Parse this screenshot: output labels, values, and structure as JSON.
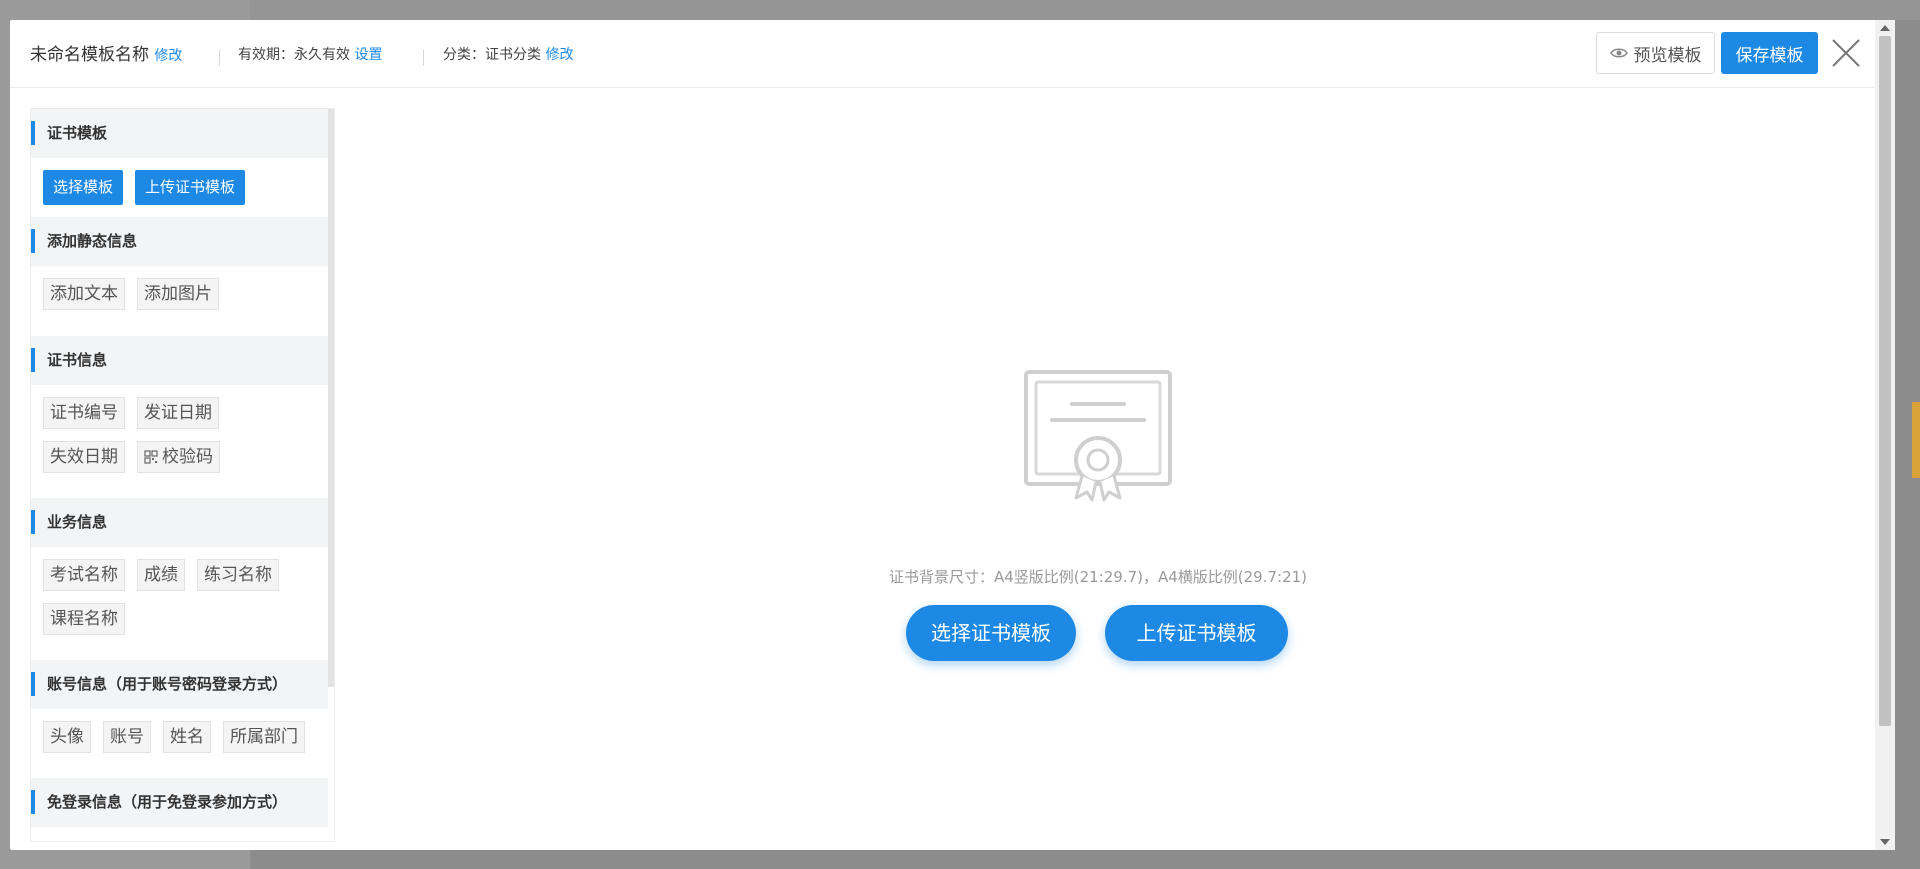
{
  "header": {
    "title": "未命名模板名称",
    "title_edit": "修改",
    "validity_label": "有效期：",
    "validity_value": "永久有效",
    "validity_link": "设置",
    "category_label": "分类：",
    "category_value": "证书分类",
    "category_link": "修改",
    "preview_button": "预览模板",
    "save_button": "保存模板"
  },
  "sidebar": {
    "template": {
      "title": "证书模板",
      "select_button": "选择模板",
      "upload_button": "上传证书模板"
    },
    "static_info": {
      "title": "添加静态信息",
      "items": [
        "添加文本",
        "添加图片"
      ]
    },
    "cert_info": {
      "title": "证书信息",
      "items": [
        "证书编号",
        "发证日期",
        "失效日期",
        "校验码"
      ]
    },
    "business_info": {
      "title": "业务信息",
      "items": [
        "考试名称",
        "成绩",
        "练习名称",
        "课程名称"
      ]
    },
    "account_info": {
      "title": "账号信息（用于账号密码登录方式）",
      "items": [
        "头像",
        "账号",
        "姓名",
        "所属部门"
      ]
    },
    "no_login_info": {
      "title": "免登录信息（用于免登录参加方式）"
    }
  },
  "main": {
    "hint": "证书背景尺寸：A4竖版比例(21:29.7)，A4横版比例(29.7:21)",
    "select_button": "选择证书模板",
    "upload_button": "上传证书模板"
  },
  "colors": {
    "accent": "#1e88e5"
  }
}
